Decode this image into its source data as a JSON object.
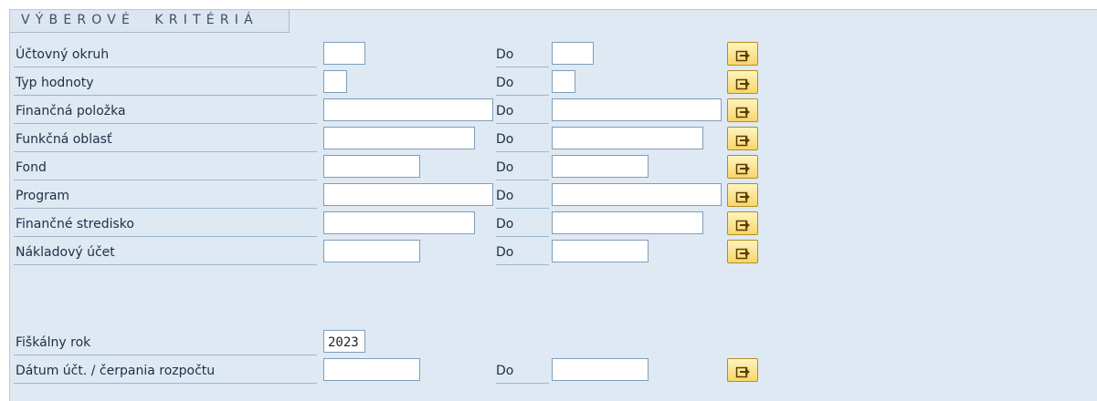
{
  "section": {
    "title": "VÝBEROVÉ  KRITÉRIÁ"
  },
  "rows": [
    {
      "label": "Účtovný okruh",
      "from_value": "",
      "to_label": "Do",
      "to_value": ""
    },
    {
      "label": "Typ hodnoty",
      "from_value": "",
      "to_label": "Do",
      "to_value": ""
    },
    {
      "label": "Finančná položka",
      "from_value": "",
      "to_label": "Do",
      "to_value": ""
    },
    {
      "label": "Funkčná oblasť",
      "from_value": "",
      "to_label": "Do",
      "to_value": ""
    },
    {
      "label": "Fond",
      "from_value": "",
      "to_label": "Do",
      "to_value": ""
    },
    {
      "label": "Program",
      "from_value": "",
      "to_label": "Do",
      "to_value": ""
    },
    {
      "label": "Finančné stredisko",
      "from_value": "",
      "to_label": "Do",
      "to_value": ""
    },
    {
      "label": "Nákladový účet",
      "from_value": "",
      "to_label": "Do",
      "to_value": ""
    }
  ],
  "fiscal_year": {
    "label": "Fiškálny rok",
    "value": "2023"
  },
  "posting_date": {
    "label": "Dátum účt. / čerpania rozpočtu",
    "from_value": "",
    "to_label": "Do",
    "to_value": ""
  },
  "icons": {
    "multiple_selection": "multiple-selection-arrow-icon"
  }
}
